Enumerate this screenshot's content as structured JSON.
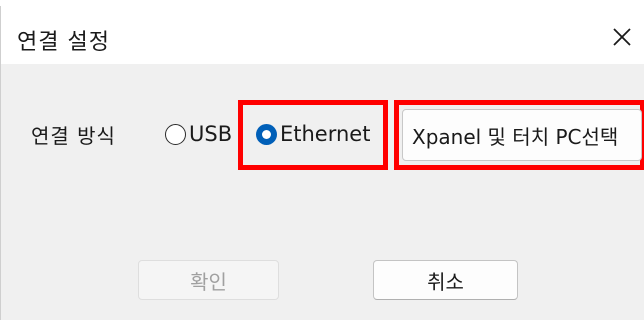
{
  "dialog": {
    "title": "연결 설정",
    "close_icon": "close-icon"
  },
  "connection": {
    "label": "연결 방식",
    "options": [
      {
        "label": "USB",
        "selected": false
      },
      {
        "label": "Ethernet",
        "selected": true
      }
    ]
  },
  "device_select": {
    "label": "Xpanel 및 터치 PC선택"
  },
  "buttons": {
    "ok_label": "확인",
    "ok_enabled": false,
    "cancel_label": "취소"
  },
  "colors": {
    "accent": "#005fb8",
    "highlight": "#ff0000",
    "dialog_bg": "#f0f0f0"
  }
}
